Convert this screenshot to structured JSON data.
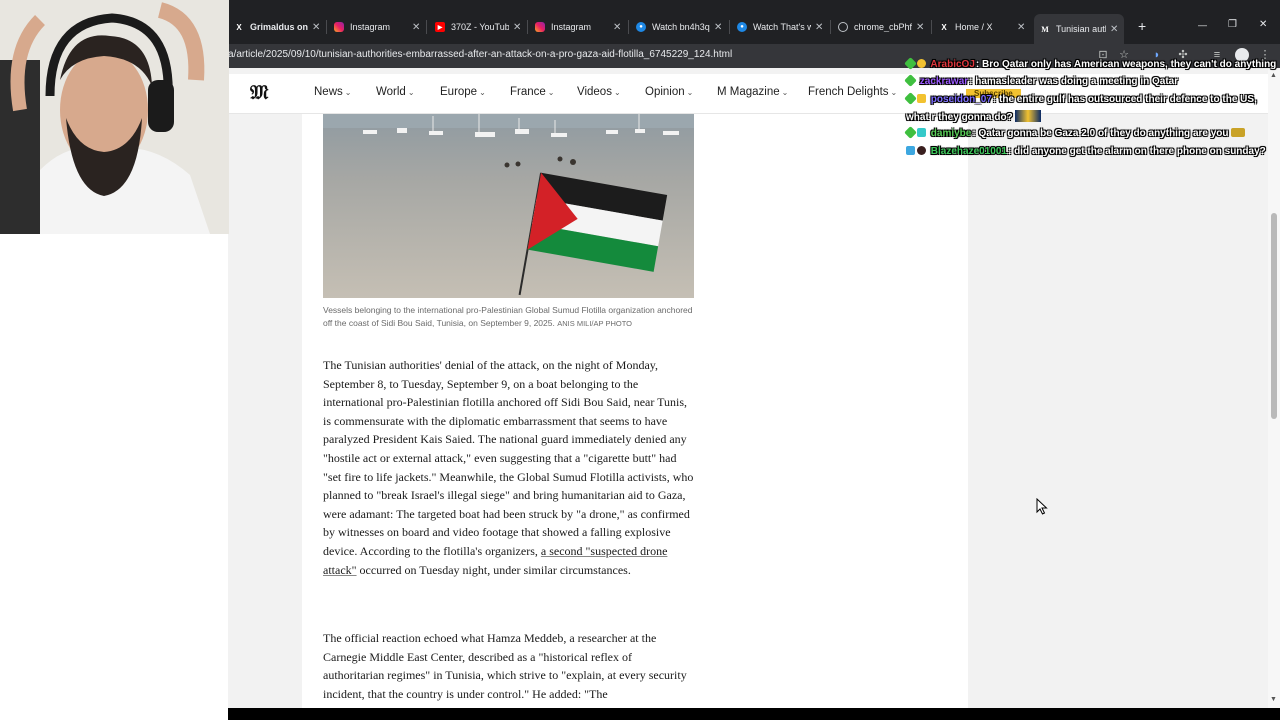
{
  "browser": {
    "tabs": [
      {
        "label": "Grimaldus on",
        "icon": "x-logo-icon",
        "close": "✕"
      },
      {
        "label": "Instagram",
        "icon": "instagram-icon",
        "close": "✕"
      },
      {
        "label": "370Z - YouTub",
        "icon": "youtube-icon",
        "close": "✕"
      },
      {
        "label": "Instagram",
        "icon": "instagram-icon",
        "close": "✕"
      },
      {
        "label": "Watch bn4h3q",
        "icon": "watch-icon",
        "close": "✕"
      },
      {
        "label": "Watch That's w",
        "icon": "watch-icon",
        "close": "✕"
      },
      {
        "label": "chrome_cbPhf",
        "icon": "globe-icon",
        "close": "✕"
      },
      {
        "label": "Home / X",
        "icon": "x-logo-icon",
        "close": "✕"
      },
      {
        "label": "Tunisian autho",
        "icon": "le-monde-icon",
        "close": "✕"
      }
    ],
    "new_tab": "+",
    "window_controls": {
      "minimize": "—",
      "maximize": "❐",
      "close": "✕"
    },
    "url": "a/article/2025/09/10/tunisian-authorities-embarrassed-after-an-attack-on-a-pro-gaza-aid-flotilla_6745229_124.html"
  },
  "site": {
    "logo": "𝔐",
    "nav": [
      "News",
      "World",
      "Europe",
      "France",
      "Videos",
      "Opinion",
      "M Magazine",
      "French Delights"
    ],
    "caret": "⌄"
  },
  "article": {
    "caption_text": "Vessels belonging to the international pro-Palestinian Global Sumud Flotilla organization anchored off the coast of Sidi Bou Said, Tunisia, on September 9, 2025.",
    "caption_credit": "ANIS MILI/AP PHOTO",
    "p1_before": "The Tunisian authorities' denial of the attack, on the night of Monday, September 8, to Tuesday, September 9, on a boat belonging to the international pro-Palestinian flotilla anchored off Sidi Bou Said, near Tunis, is commensurate with the diplomatic embarrassment that seems to have paralyzed President Kais Saied. The national guard immediately denied any \"hostile act or external attack,\" even suggesting that a \"cigarette butt\" had \"set fire to life jackets.\" Meanwhile, the Global Sumud Flotilla activists, who planned to \"break Israel's illegal siege\" and bring humanitarian aid to Gaza, were adamant: The targeted boat had been struck by \"a drone,\" as confirmed by witnesses on board and video footage that showed a falling explosive device. According to the flotilla's organizers,",
    "p1_link": "a second \"suspected drone attack\"",
    "p1_after": "occurred on Tuesday night, under similar circumstances.",
    "p2": "The official reaction echoed what Hamza Meddeb, a researcher at the Carnegie Middle East Center, described as a \"historical reflex of authoritarian regimes\" in Tunisia, which strive to \"explain, at every security incident, that the country is under control.\" He added: \"The"
  },
  "chat": [
    {
      "user": "ArabicOJ",
      "text": "Bro Qatar only has American weapons, they can't do anything",
      "user_color": "#e0373e"
    },
    {
      "user": "zackrawar",
      "text": "hamasleader was doing a meeting in Qatar",
      "user_color": "#9b59ff",
      "badge_extra": "Subscribe"
    },
    {
      "user": "poseidon_07",
      "text": "the entire gulf has outsourced their defence to the US, what r they gonna do?",
      "user_color": "#7d6cff"
    },
    {
      "user": "damiybe",
      "text": "Qatar gonna be Gaza 2.0 of they do anything are you",
      "user_color": "#5ad15a"
    },
    {
      "user": "Blazehaze01001",
      "text": "did anyone get the alarm on there phone on sunday?",
      "user_color": "#3ec95c"
    }
  ],
  "colors": {
    "tab_bg": "#202124",
    "active_tab_bg": "#35363a",
    "page_bg": "#f2f2f2",
    "article_bg": "#ffffff",
    "flag_red": "#d32127",
    "flag_green": "#148a3c"
  }
}
